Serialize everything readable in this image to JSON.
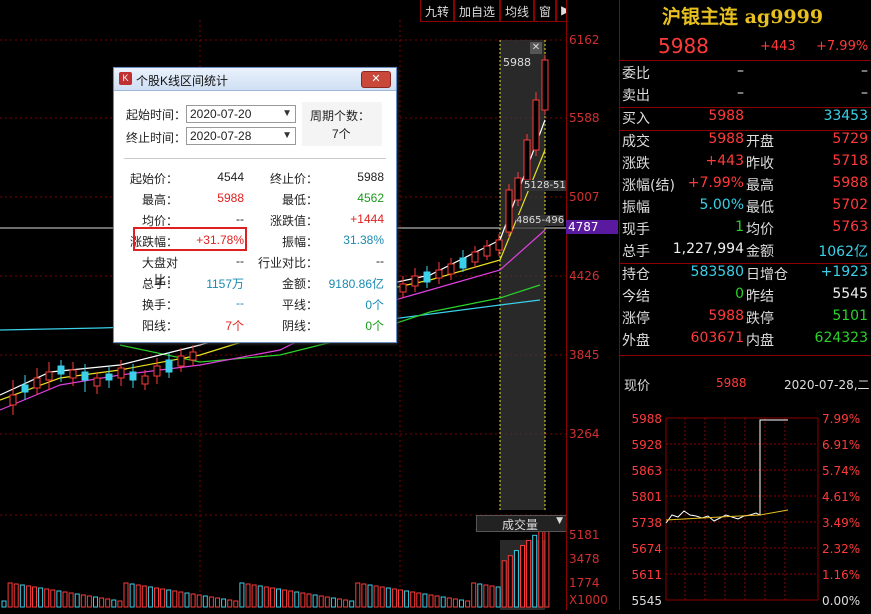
{
  "toolbar": {
    "buttons": [
      "九转",
      "加自选",
      "均线",
      "窗"
    ]
  },
  "price_axis": {
    "labels": [
      "6162",
      "5588",
      "5007",
      "4426",
      "3845",
      "3264"
    ],
    "current_tag": "4787",
    "volume_labels": [
      "5181",
      "3478",
      "1774",
      "X1000"
    ]
  },
  "chart": {
    "overlay_top": "5988",
    "overlay_mid1": "5128-51",
    "overlay_mid2": "4865-496",
    "volume_tab": "成交量"
  },
  "instrument": {
    "name": "沪银主连 ag9999",
    "price": "5988",
    "change": "+443",
    "change_pct": "+7.99%"
  },
  "quote_rows": [
    {
      "k": "委比",
      "v": "–",
      "k2": "",
      "v2": "–",
      "vc": "white",
      "v2c": "white"
    },
    {
      "k": "卖出",
      "v": "–",
      "k2": "",
      "v2": "–",
      "vc": "white",
      "v2c": "white"
    }
  ],
  "buy_row": {
    "k": "买入",
    "v": "5988",
    "v2": "33453"
  },
  "stats_rows": [
    {
      "k": "成交",
      "v": "5988",
      "vc": "red",
      "k2": "开盘",
      "v2": "5729",
      "v2c": "red"
    },
    {
      "k": "涨跌",
      "v": "+443",
      "vc": "red",
      "k2": "昨收",
      "v2": "5718",
      "v2c": "red"
    },
    {
      "k": "涨幅(结)",
      "v": "+7.99%",
      "vc": "red",
      "k2": "最高",
      "v2": "5988",
      "v2c": "red"
    },
    {
      "k": "振幅",
      "v": "5.00%",
      "vc": "cyan",
      "k2": "最低",
      "v2": "5702",
      "v2c": "red"
    },
    {
      "k": "现手",
      "v": "1",
      "vc": "green",
      "k2": "均价",
      "v2": "5763",
      "v2c": "red"
    },
    {
      "k": "总手",
      "v": "1,227,994",
      "vc": "white",
      "k2": "金额",
      "v2": "1062亿",
      "v2c": "cyan"
    }
  ],
  "pos_rows": [
    {
      "k": "持仓",
      "v": "583580",
      "vc": "cyan",
      "k2": "日增仓",
      "v2": "+1923",
      "v2c": "cyan"
    },
    {
      "k": "今结",
      "v": "0",
      "vc": "green",
      "k2": "昨结",
      "v2": "5545",
      "v2c": "white"
    },
    {
      "k": "涨停",
      "v": "5988",
      "vc": "red",
      "k2": "跌停",
      "v2": "5101",
      "v2c": "green"
    },
    {
      "k": "外盘",
      "v": "603671",
      "vc": "red",
      "k2": "内盘",
      "v2": "624323",
      "v2c": "green"
    }
  ],
  "mini": {
    "label": "现价",
    "price": "5988",
    "date": "2020-07-28,二",
    "left_labels": [
      "5988",
      "5928",
      "5863",
      "5801",
      "5738",
      "5674",
      "5611",
      "5545"
    ],
    "right_labels": [
      "7.99%",
      "6.91%",
      "5.74%",
      "4.61%",
      "3.49%",
      "2.32%",
      "1.16%",
      "0.00%"
    ]
  },
  "dialog": {
    "title": "个股K线区间统计",
    "start_label": "起始时间：",
    "start_value": "2020-07-20",
    "end_label": "终止时间：",
    "end_value": "2020-07-28",
    "period_label": "周期个数：",
    "period_value": "7个",
    "close_button": "✕",
    "stats": [
      {
        "k": "起始价：",
        "v": "4544",
        "vc": "#222",
        "k2": "终止价：",
        "v2": "5988",
        "v2c": "#222"
      },
      {
        "k": "最高：",
        "v": "5988",
        "vc": "#e02020",
        "k2": "最低：",
        "v2": "4562",
        "v2c": "#1a9a1a"
      },
      {
        "k": "均价：",
        "v": "--",
        "vc": "#222",
        "k2": "涨跌值：",
        "v2": "+1444",
        "v2c": "#e02020"
      },
      {
        "k": "涨跌幅：",
        "v": "+31.78%",
        "vc": "#e02020",
        "k2": "振幅：",
        "v2": "31.38%",
        "v2c": "#1a8ab0"
      },
      {
        "k": "大盘对比：",
        "v": "--",
        "vc": "#222",
        "k2": "行业对比：",
        "v2": "--",
        "v2c": "#222"
      },
      {
        "k": "总手：",
        "v": "1157万",
        "vc": "#1a8ab0",
        "k2": "金额：",
        "v2": "9180.86亿",
        "v2c": "#1a8ab0"
      },
      {
        "k": "换手：",
        "v": "--",
        "vc": "#1a8ab0",
        "k2": "平线：",
        "v2": "0个",
        "v2c": "#1a8ab0"
      },
      {
        "k": "阳线：",
        "v": "7个",
        "vc": "#e02020",
        "k2": "阴线：",
        "v2": "0个",
        "v2c": "#1a9a1a"
      }
    ]
  }
}
